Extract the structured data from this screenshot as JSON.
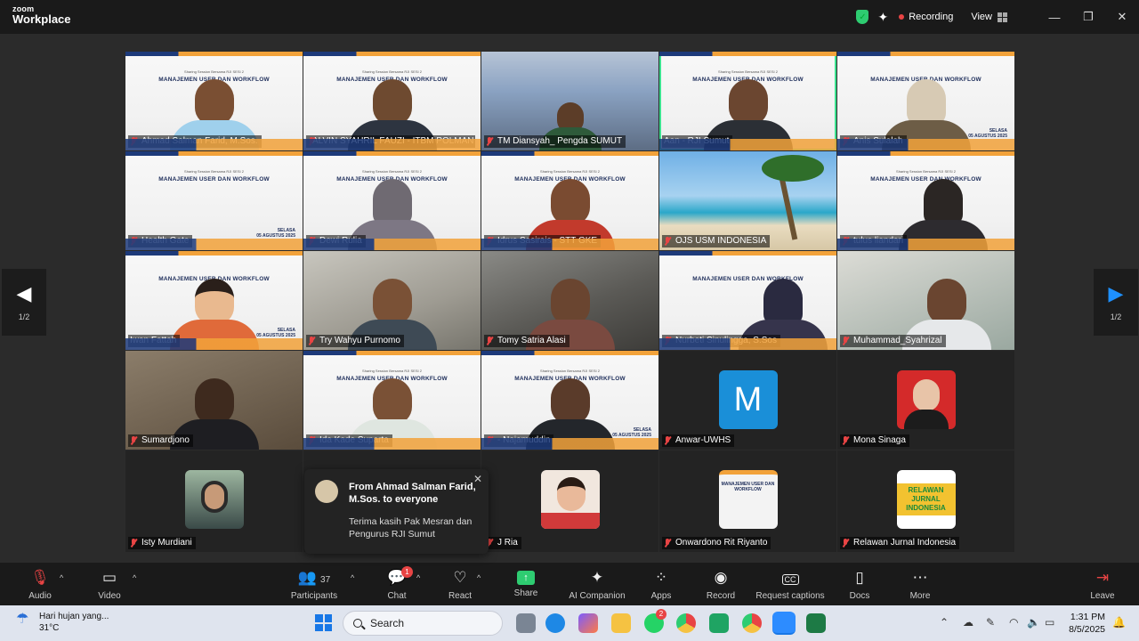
{
  "app": {
    "brand_small": "zoom",
    "brand_big": "Workplace"
  },
  "titlebar": {
    "recording": "Recording",
    "view": "View",
    "minimize": "—",
    "restore": "❐",
    "close": "✕"
  },
  "pager": {
    "left_label": "1/2",
    "right_label": "1/2"
  },
  "slide": {
    "subtitle": "Sharing Session Bersama RJI SESI 2",
    "title": "MANAJEMEN USER DAN WORKFLOW",
    "date_day": "SELASA",
    "date": "05 AGUSTUS 2025"
  },
  "participants_tiles": [
    "Ahmad Salman Farid, M.Sos.",
    "ALVIN SYAHRIL FAUZI - ITBM POLMAN",
    "TM Diansyah_ Pengda SUMUT",
    "Aan - RJI Sumut",
    "Anis Sulalah",
    "Health Gate",
    "Dewi Rulia",
    "Idrus Sasirais - STT GKE",
    "OJS USM INDONESIA",
    "tulus liandari",
    "Iwan Fattah",
    "Try Wahyu Purnomo",
    "Tomy Satria Alasi",
    "Nurbeti Sinulingga, S.Sos",
    "Muhammad_Syahrizal",
    "Sumardjono",
    "Ida Kade Suparta",
    "- Najamuddin",
    "Anwar-UWHS",
    "Mona Sinaga",
    "Isty Murdiani",
    "J Ria",
    "Onwardono Rit Riyanto",
    "Relawan Jurnal Indonesia"
  ],
  "avatars": {
    "anwar_letter": "M",
    "relawan_logo": "RELAWAN JURNAL INDONESIA"
  },
  "chat_popup": {
    "from": "From Ahmad Salman Farid, M.Sos. to everyone",
    "message": "Terima kasih Pak Mesran dan Pengurus RJI Sumut",
    "close": "✕"
  },
  "toolbar": {
    "audio": "Audio",
    "video": "Video",
    "participants": "Participants",
    "participants_count": "37",
    "chat": "Chat",
    "chat_badge": "1",
    "react": "React",
    "share": "Share",
    "ai_companion": "AI Companion",
    "apps": "Apps",
    "apps_badge": "",
    "record": "Record",
    "captions": "Request captions",
    "docs": "Docs",
    "more": "More",
    "leave": "Leave"
  },
  "taskbar": {
    "weather_text": "Hari hujan yang...",
    "temp": "31°C",
    "search_placeholder": "Search",
    "whatsapp_badge": "2",
    "time": "1:31 PM",
    "date": "8/5/2025"
  },
  "colors": {
    "active_speaker": "#3ce28f",
    "mute_red": "#e84444",
    "share_green": "#2ecc71",
    "slide_navy": "#1d2d5a",
    "slide_orange": "#f2a23a"
  }
}
